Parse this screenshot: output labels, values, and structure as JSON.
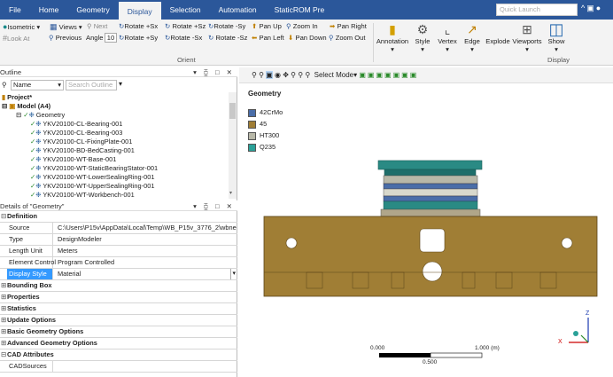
{
  "menu": {
    "tabs": [
      "File",
      "Home",
      "Geometry",
      "Display",
      "Selection",
      "Automation",
      "StaticROM Pre"
    ],
    "active": "Display",
    "quick_launch_placeholder": "Quick Launch"
  },
  "ribbon": {
    "isometric": "Isometric",
    "views": "Views",
    "lookat": "Look At",
    "next": "Next",
    "previous": "Previous",
    "angle_label": "Angle",
    "angle_value": "10",
    "rot_px": "Rotate +Sx",
    "rot_py": "Rotate +Sy",
    "rot_pz": "Rotate +Sz",
    "rot_mx": "Rotate -Sx",
    "rot_my": "Rotate -Sy",
    "rot_mz": "Rotate -Sz",
    "pan_up": "Pan Up",
    "pan_left": "Pan Left",
    "pan_down": "Pan Down",
    "pan_right": "Pan Right",
    "zoom_in": "Zoom In",
    "zoom_out": "Zoom Out",
    "orient_group": "Orient",
    "annotation": "Annotation",
    "style": "Style",
    "vertex": "Vertex",
    "edge": "Edge",
    "explode": "Explode",
    "viewports": "Viewports",
    "show": "Show",
    "display_group": "Display"
  },
  "outline": {
    "title": "Outline",
    "filter_name": "Name",
    "search_placeholder": "Search Outline",
    "project": "Project*",
    "model": "Model (A4)",
    "geometry": "Geometry",
    "items": [
      "YKV20100-CL-Bearing-001",
      "YKV20100-CL-Bearing-003",
      "YKV20100-CL-FixingPlate-001",
      "YKV20100-BD-BedCasting-001",
      "YKV20100-WT-Base-001",
      "YKV20100-WT-StaticBearingStator-001",
      "YKV20100-WT-LowerSealingRing-001",
      "YKV20100-WT-UpperSealingRing-001",
      "YKV20100-WT-Workbench-001"
    ]
  },
  "details": {
    "title": "Details of \"Geometry\"",
    "rows": [
      {
        "type": "sec",
        "label": "Definition"
      },
      {
        "type": "kv",
        "k": "Source",
        "v": "C:\\Users\\P15v\\AppData\\Local\\Temp\\WB_P15v_3776_2\\wbne..."
      },
      {
        "type": "kv",
        "k": "Type",
        "v": "DesignModeler"
      },
      {
        "type": "kv",
        "k": "Length Unit",
        "v": "Meters"
      },
      {
        "type": "kv",
        "k": "Element Control",
        "v": "Program Controlled"
      },
      {
        "type": "kv",
        "k": "Display Style",
        "v": "Material",
        "hl": true
      },
      {
        "type": "sec",
        "label": "Bounding Box"
      },
      {
        "type": "sec",
        "label": "Properties"
      },
      {
        "type": "sec",
        "label": "Statistics"
      },
      {
        "type": "sec",
        "label": "Update Options"
      },
      {
        "type": "sec",
        "label": "Basic Geometry Options"
      },
      {
        "type": "sec",
        "label": "Advanced Geometry Options"
      },
      {
        "type": "sec",
        "label": "CAD Attributes"
      },
      {
        "type": "kv",
        "k": "CADSources",
        "v": ""
      }
    ]
  },
  "graphics": {
    "toolbar_select": "Select",
    "toolbar_mode": "Mode",
    "title": "Geometry",
    "legend": [
      {
        "name": "42CrMo",
        "color": "#4a6da8"
      },
      {
        "name": "45",
        "color": "#a07e35"
      },
      {
        "name": "HT300",
        "color": "#b8b8a8"
      },
      {
        "name": "Q235",
        "color": "#2aa198"
      }
    ],
    "scale": {
      "left": "0.000",
      "right": "1.000 (m)",
      "mid": "0.500"
    },
    "axes": {
      "z": "Z",
      "x": "X"
    }
  }
}
